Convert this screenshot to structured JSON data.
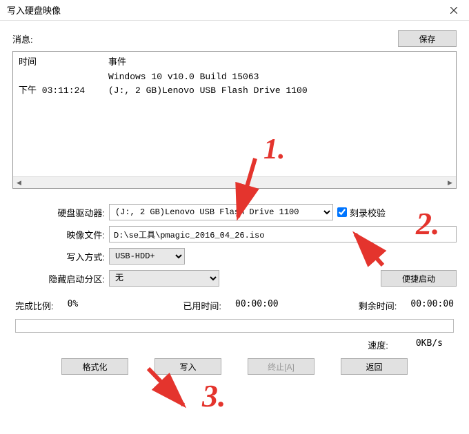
{
  "window": {
    "title": "写入硬盘映像"
  },
  "msg": {
    "label": "消息:",
    "save_btn": "保存"
  },
  "list": {
    "col_time": "时间",
    "col_event": "事件",
    "rows": [
      {
        "time": "",
        "event": "Windows 10 v10.0 Build 15063"
      },
      {
        "time": "下午 03:11:24",
        "event": "(J:, 2 GB)Lenovo  USB Flash Drive 1100"
      }
    ]
  },
  "form": {
    "drive_label": "硬盘驱动器:",
    "drive_value": "(J:, 2 GB)Lenovo  USB Flash Drive 1100",
    "verify_label": "刻录校验",
    "verify_checked": true,
    "image_label": "映像文件:",
    "image_value": "D:\\se工具\\pmagic_2016_04_26.iso",
    "method_label": "写入方式:",
    "method_value": "USB-HDD+",
    "hidden_label": "隐藏启动分区:",
    "hidden_value": "无",
    "quick_boot_btn": "便捷启动"
  },
  "stats": {
    "done_label": "完成比例:",
    "done_value": "0%",
    "elapsed_label": "已用时间:",
    "elapsed_value": "00:00:00",
    "remain_label": "剩余时间:",
    "remain_value": "00:00:00",
    "speed_label": "速度:",
    "speed_value": "0KB/s"
  },
  "buttons": {
    "format": "格式化",
    "write": "写入",
    "stop": "终止[A]",
    "back": "返回"
  },
  "annotations": {
    "one": "1.",
    "two": "2.",
    "three": "3."
  }
}
